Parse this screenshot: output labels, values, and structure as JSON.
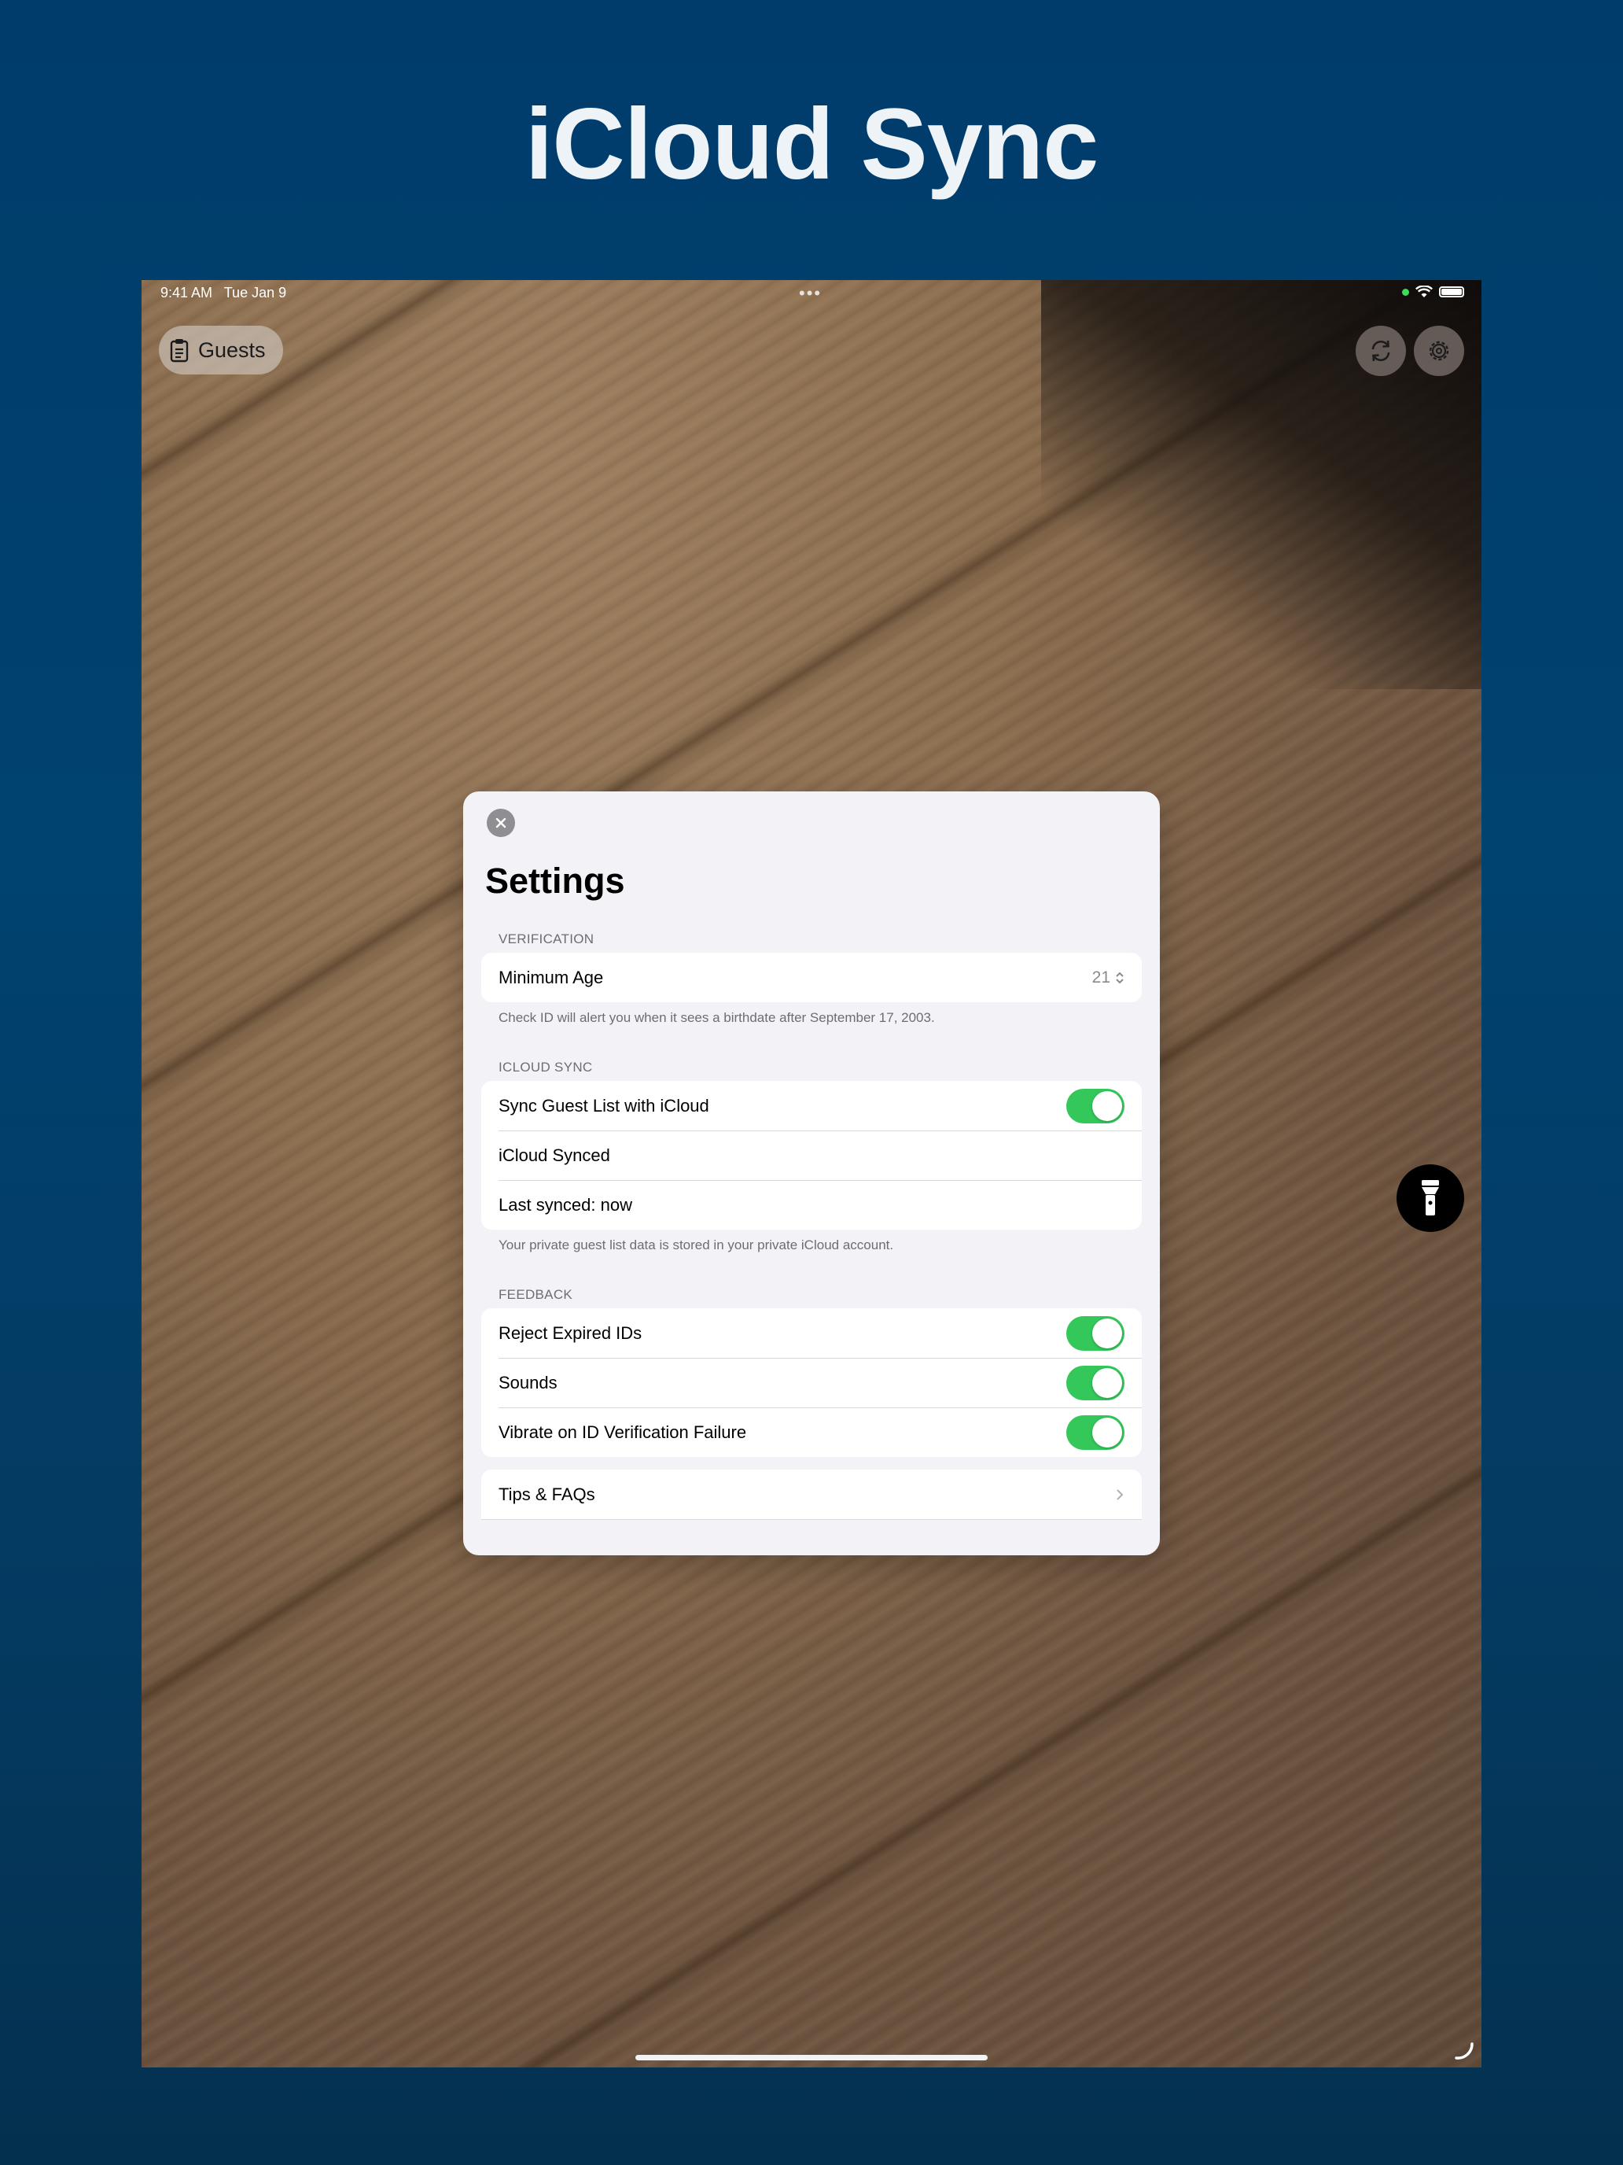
{
  "promo": {
    "title": "iCloud Sync"
  },
  "status_bar": {
    "time": "9:41 AM",
    "date": "Tue Jan 9",
    "dots": "•••"
  },
  "toolbar": {
    "guests_label": "Guests"
  },
  "icons": {
    "clipboard": "clipboard-icon",
    "sync": "sync-icon",
    "settings": "gear-icon",
    "flashlight": "flashlight-icon",
    "close": "close-icon",
    "chevron": "chevron-right-icon",
    "stepper": "up-down-chevron-icon"
  },
  "colors": {
    "background": "#003c6b",
    "toggle_on": "#34c759",
    "sheet": "#f2f2f7"
  },
  "settings": {
    "title": "Settings",
    "verification": {
      "header": "VERIFICATION",
      "minimum_age_label": "Minimum Age",
      "minimum_age_value": "21",
      "footnote": "Check ID will alert you when it sees a birthdate after September 17, 2003."
    },
    "icloud_sync": {
      "header": "ICLOUD SYNC",
      "sync_label": "Sync Guest List with iCloud",
      "sync_enabled": true,
      "status": "iCloud Synced",
      "last_synced": "Last synced: now",
      "footnote": "Your private guest list data is stored in your private iCloud account."
    },
    "feedback": {
      "header": "FEEDBACK",
      "items": [
        {
          "label": "Reject Expired IDs",
          "enabled": true
        },
        {
          "label": "Sounds",
          "enabled": true
        },
        {
          "label": "Vibrate on ID Verification Failure",
          "enabled": true
        }
      ]
    },
    "links": {
      "tips_label": "Tips & FAQs"
    }
  }
}
